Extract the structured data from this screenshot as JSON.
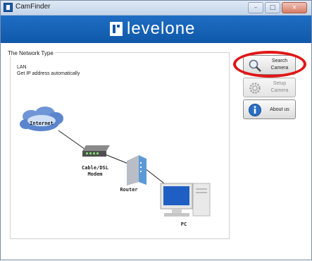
{
  "window": {
    "title": "CamFinder",
    "controls": {
      "minimize": "–",
      "maximize": "□",
      "close": "×"
    }
  },
  "brand": {
    "name": "levelone"
  },
  "network": {
    "title": "The Network Type",
    "type_line": "LAN",
    "mode_line": "Get IP address automatically",
    "nodes": {
      "internet": "Internet",
      "modem_line1": "Cable/DSL",
      "modem_line2": "Modem",
      "router": "Router",
      "pc": "PC"
    }
  },
  "buttons": {
    "search": {
      "line1": "Search",
      "line2": "Camera",
      "icon": "magnifier-icon"
    },
    "setup": {
      "line1": "Setup",
      "line2": "Camera",
      "icon": "gear-icon"
    },
    "about": {
      "label": "About us",
      "icon": "info-icon"
    }
  },
  "colors": {
    "brand_blue": "#1058a9",
    "highlight_red": "#e11616"
  }
}
